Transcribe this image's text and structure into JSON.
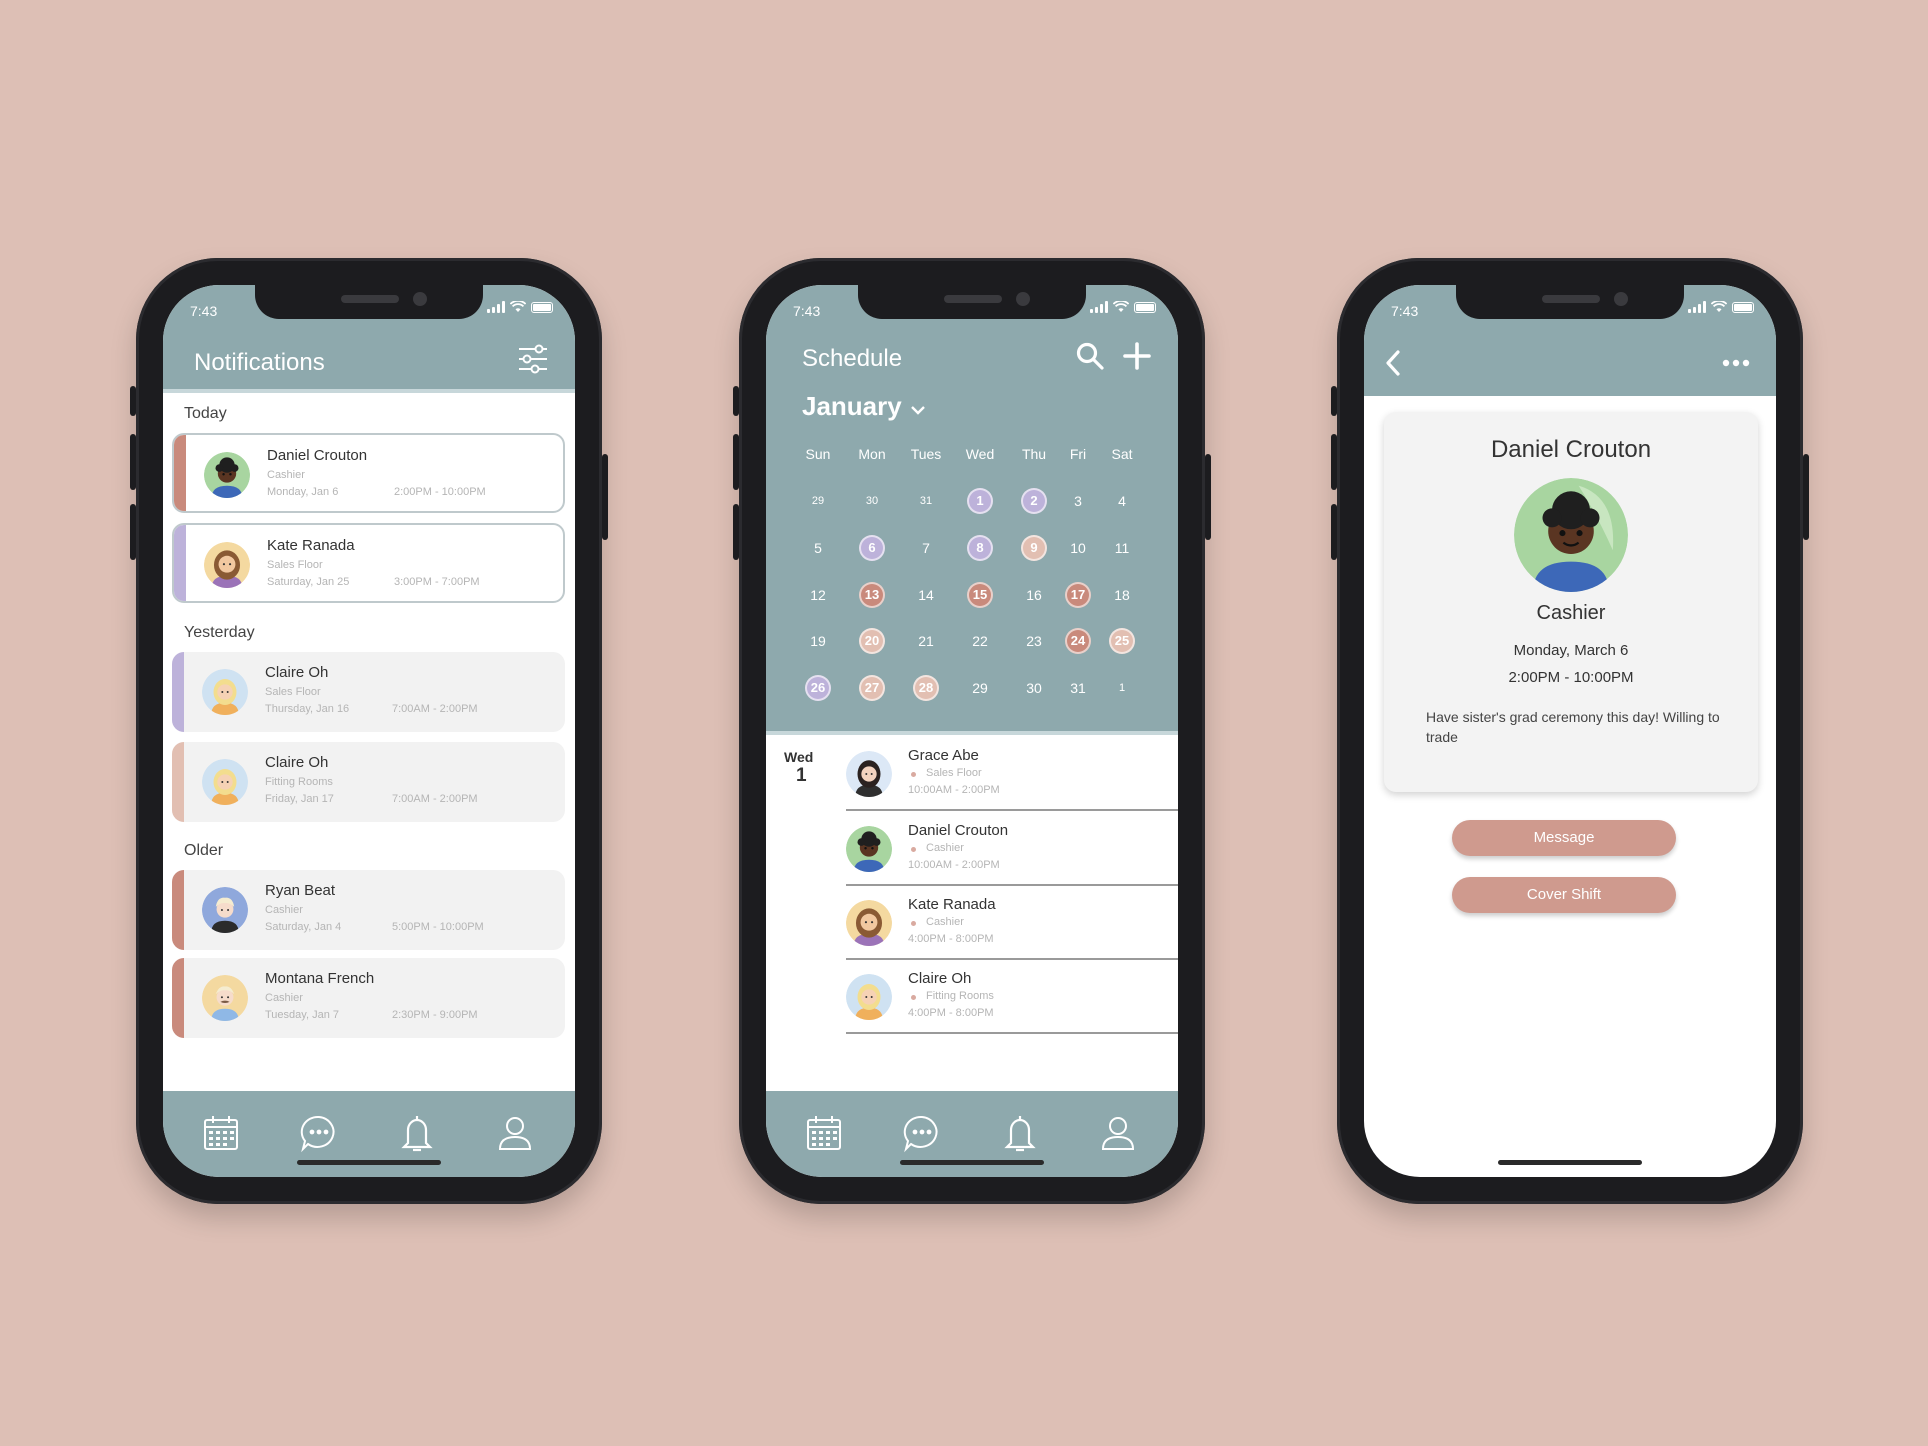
{
  "colors": {
    "background": "#ddbfb5",
    "header": "#8ea9ad",
    "accent": "#cf9a8e",
    "purple": "#bdb2da",
    "rose": "#c98a7c",
    "peach": "#e2bfb2"
  },
  "status_bar": {
    "time": "7:43"
  },
  "notifications": {
    "title": "Notifications",
    "sections": [
      {
        "label": "Today"
      },
      {
        "label": "Yesterday"
      },
      {
        "label": "Older"
      }
    ],
    "items": [
      {
        "name": "Daniel Crouton",
        "role": "Cashier",
        "date": "Monday, Jan 6",
        "hours": "2:00PM - 10:00PM"
      },
      {
        "name": "Kate Ranada",
        "role": "Sales Floor",
        "date": "Saturday, Jan 25",
        "hours": "3:00PM - 7:00PM"
      },
      {
        "name": "Claire Oh",
        "role": "Sales Floor",
        "date": "Thursday, Jan 16",
        "hours": "7:00AM - 2:00PM"
      },
      {
        "name": "Claire Oh",
        "role": "Fitting Rooms",
        "date": "Friday, Jan 17",
        "hours": "7:00AM - 2:00PM"
      },
      {
        "name": "Ryan Beat",
        "role": "Cashier",
        "date": "Saturday, Jan 4",
        "hours": "5:00PM - 10:00PM"
      },
      {
        "name": "Montana French",
        "role": "Cashier",
        "date": "Tuesday, Jan 7",
        "hours": "2:30PM - 9:00PM"
      }
    ]
  },
  "schedule": {
    "title": "Schedule",
    "month": "January",
    "weekdays": [
      "Sun",
      "Mon",
      "Tues",
      "Wed",
      "Thu",
      "Fri",
      "Sat"
    ],
    "weeks": [
      [
        "29",
        "30",
        "31",
        "1",
        "2",
        "3",
        "4"
      ],
      [
        "5",
        "6",
        "7",
        "8",
        "9",
        "10",
        "11"
      ],
      [
        "12",
        "13",
        "14",
        "15",
        "16",
        "17",
        "18"
      ],
      [
        "19",
        "20",
        "21",
        "22",
        "23",
        "24",
        "25"
      ],
      [
        "26",
        "27",
        "28",
        "29",
        "30",
        "31",
        "1"
      ]
    ],
    "selected_day": {
      "weekday": "Wed",
      "day": "1"
    },
    "shifts": [
      {
        "name": "Grace Abe",
        "role": "Sales Floor",
        "hours": "10:00AM - 2:00PM"
      },
      {
        "name": "Daniel Crouton",
        "role": "Cashier",
        "hours": "10:00AM - 2:00PM"
      },
      {
        "name": "Kate Ranada",
        "role": "Cashier",
        "hours": "4:00PM - 8:00PM"
      },
      {
        "name": "Claire Oh",
        "role": "Fitting Rooms",
        "hours": "4:00PM - 8:00PM"
      }
    ]
  },
  "detail": {
    "name": "Daniel Crouton",
    "role": "Cashier",
    "date": "Monday, March 6",
    "hours": "2:00PM - 10:00PM",
    "note": "Have sister's grad ceremony this day! Willing to trade",
    "buttons": {
      "message": "Message",
      "cover": "Cover Shift"
    }
  },
  "tabs": [
    "calendar-icon",
    "chat-icon",
    "bell-icon",
    "profile-icon"
  ]
}
